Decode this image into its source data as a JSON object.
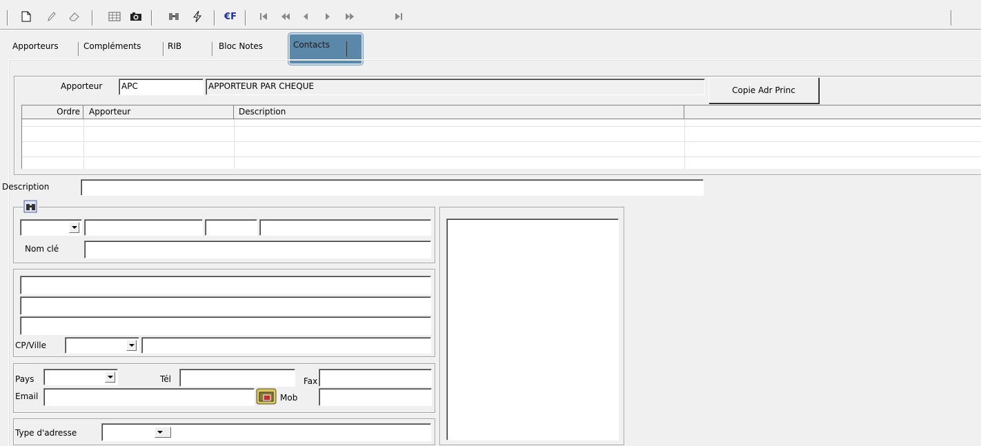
{
  "toolbar": {
    "icons": [
      "new-document-icon",
      "edit-pencil-icon",
      "eraser-icon",
      "grid-icon",
      "camera-icon",
      "binoculars-icon",
      "lightning-icon",
      "euro-franc-icon",
      "first-record-icon",
      "previous-page-icon",
      "previous-record-icon",
      "next-record-icon",
      "next-page-icon",
      "last-record-icon"
    ],
    "euro_label": "€F"
  },
  "tabs": [
    {
      "label": "Apporteurs",
      "active": false
    },
    {
      "label": "Compléments",
      "active": false
    },
    {
      "label": "RIB",
      "active": false
    },
    {
      "label": "Bloc Notes",
      "active": false
    },
    {
      "label": "Contacts",
      "active": true
    }
  ],
  "apporteur": {
    "label": "Apporteur",
    "code": "APC",
    "name": "APPORTEUR PAR CHEQUE",
    "copy_button": "Copie Adr Princ"
  },
  "grid": {
    "columns": [
      "Ordre",
      "Apporteur",
      "Description"
    ],
    "rows": []
  },
  "form": {
    "description_label": "Description",
    "description_value": "",
    "nom_cle_label": "Nom clé",
    "cp_ville_label": "CP/Ville",
    "pays_label": "Pays",
    "tel_label": "Tél",
    "fax_label": "Fax",
    "email_label": "Email",
    "mob_label": "Mob",
    "type_adresse_label": "Type d'adresse"
  },
  "colors": {
    "background": "#f0f0f0",
    "active_tab": "#5b87a8"
  }
}
